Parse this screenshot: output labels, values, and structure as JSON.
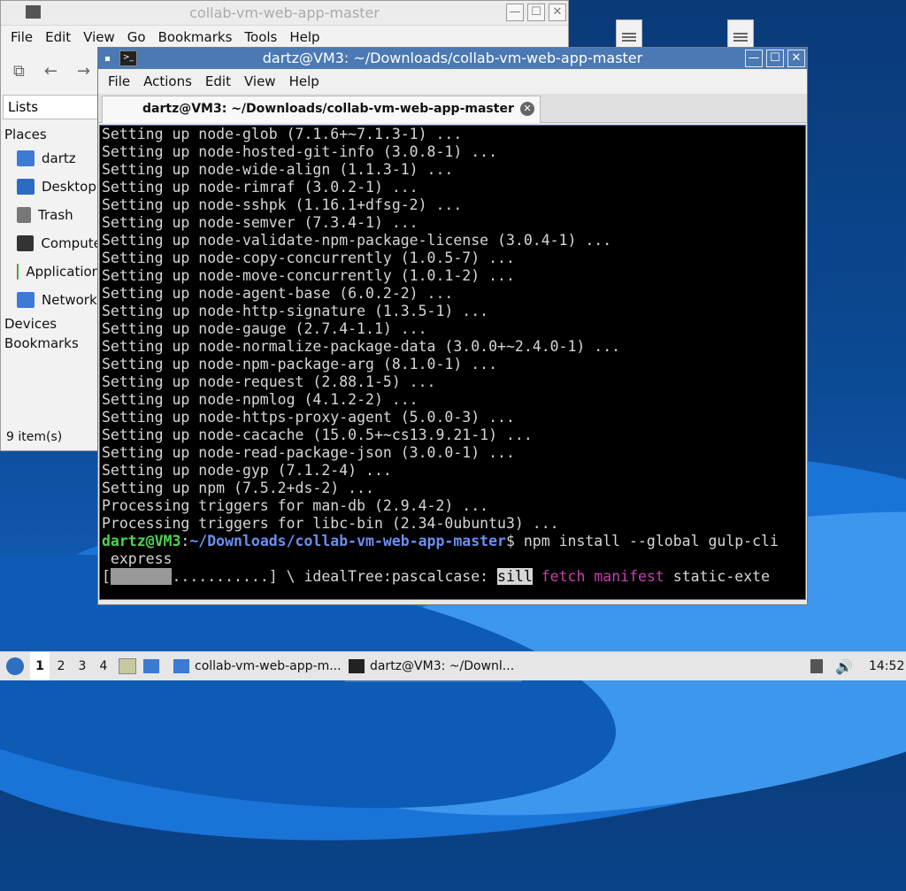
{
  "file_manager": {
    "title": "collab-vm-web-app-master",
    "menu": [
      "File",
      "Edit",
      "View",
      "Go",
      "Bookmarks",
      "Tools",
      "Help"
    ],
    "toolbar_icons": [
      "new-window-icon",
      "back-icon",
      "forward-icon"
    ],
    "lists_label": "Lists",
    "places_header": "Places",
    "places": [
      "dartz",
      "Desktop",
      "Trash",
      "Computer",
      "Applications",
      "Network"
    ],
    "devices_header": "Devices",
    "bookmarks_header": "Bookmarks",
    "status": "9 item(s)"
  },
  "terminal": {
    "title": "dartz@VM3: ~/Downloads/collab-vm-web-app-master",
    "menu": [
      "File",
      "Actions",
      "Edit",
      "View",
      "Help"
    ],
    "tab_label": "dartz@VM3: ~/Downloads/collab-vm-web-app-master",
    "output_lines": [
      "Setting up node-glob (7.1.6+~7.1.3-1) ...",
      "Setting up node-hosted-git-info (3.0.8-1) ...",
      "Setting up node-wide-align (1.1.3-1) ...",
      "Setting up node-rimraf (3.0.2-1) ...",
      "Setting up node-sshpk (1.16.1+dfsg-2) ...",
      "Setting up node-semver (7.3.4-1) ...",
      "Setting up node-validate-npm-package-license (3.0.4-1) ...",
      "Setting up node-copy-concurrently (1.0.5-7) ...",
      "Setting up node-move-concurrently (1.0.1-2) ...",
      "Setting up node-agent-base (6.0.2-2) ...",
      "Setting up node-http-signature (1.3.5-1) ...",
      "Setting up node-gauge (2.7.4-1.1) ...",
      "Setting up node-normalize-package-data (3.0.0+~2.4.0-1) ...",
      "Setting up node-npm-package-arg (8.1.0-1) ...",
      "Setting up node-request (2.88.1-5) ...",
      "Setting up node-npmlog (4.1.2-2) ...",
      "Setting up node-https-proxy-agent (5.0.0-3) ...",
      "Setting up node-cacache (15.0.5+~cs13.9.21-1) ...",
      "Setting up node-read-package-json (3.0.0-1) ...",
      "Setting up node-gyp (7.1.2-4) ...",
      "Setting up npm (7.5.2+ds-2) ...",
      "Processing triggers for man-db (2.9.4-2) ...",
      "Processing triggers for libc-bin (2.34-0ubuntu3) ..."
    ],
    "prompt_user": "dartz@VM3",
    "prompt_colon": ":",
    "prompt_path": "~/Downloads/collab-vm-web-app-master",
    "prompt_command": "$ npm install --global gulp-cli",
    "command_wrap": " express",
    "progress": {
      "open": "[",
      "filled": "#######",
      "empty": "...........",
      "close": "] \\ idealTree:pascalcase: ",
      "sill": "sill",
      "space": " ",
      "fetch": "fetch",
      "manifest": "manifest",
      "tail": " static-exte",
      "fraction": 0.39
    }
  },
  "taskbar": {
    "workspaces": [
      "1",
      "2",
      "3",
      "4"
    ],
    "active_workspace": "1",
    "tasks": [
      "collab-vm-web-app-m...",
      "dartz@VM3: ~/Downl..."
    ],
    "clock": "14:52"
  },
  "colors": {
    "terminal_bg": "#000000",
    "prompt_user": "#4fd44f",
    "prompt_path": "#6c8ef0",
    "highlight_magenta": "#c73fb0",
    "title_bar_active": "#4b79b3"
  }
}
